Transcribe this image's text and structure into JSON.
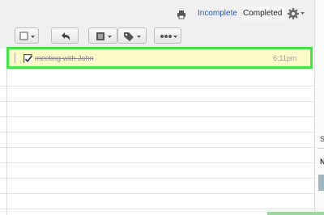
{
  "header": {
    "print_icon": "printer-icon",
    "filter_incomplete": "Incomplete",
    "filter_completed": "Completed",
    "settings_icon": "gear-icon"
  },
  "toolbar": {
    "buttons": [
      {
        "icon": "checkbox-icon",
        "has_dropdown": true
      },
      {
        "icon": "undo-arrow-icon",
        "has_dropdown": false
      },
      {
        "icon": "list-icon",
        "has_dropdown": true
      },
      {
        "icon": "tag-icon",
        "has_dropdown": true
      },
      {
        "icon": "more-dots-icon",
        "has_dropdown": true
      }
    ]
  },
  "tasks": [
    {
      "title": "meeting with John",
      "time": "6:11pm",
      "completed": true,
      "selected": true
    }
  ],
  "right_panel": {
    "letter_s": "S",
    "letter_n": "N"
  },
  "colors": {
    "highlight_border": "#44e34a",
    "selected_row_bg": "#fdfcc8",
    "link": "#2a5aa8"
  }
}
